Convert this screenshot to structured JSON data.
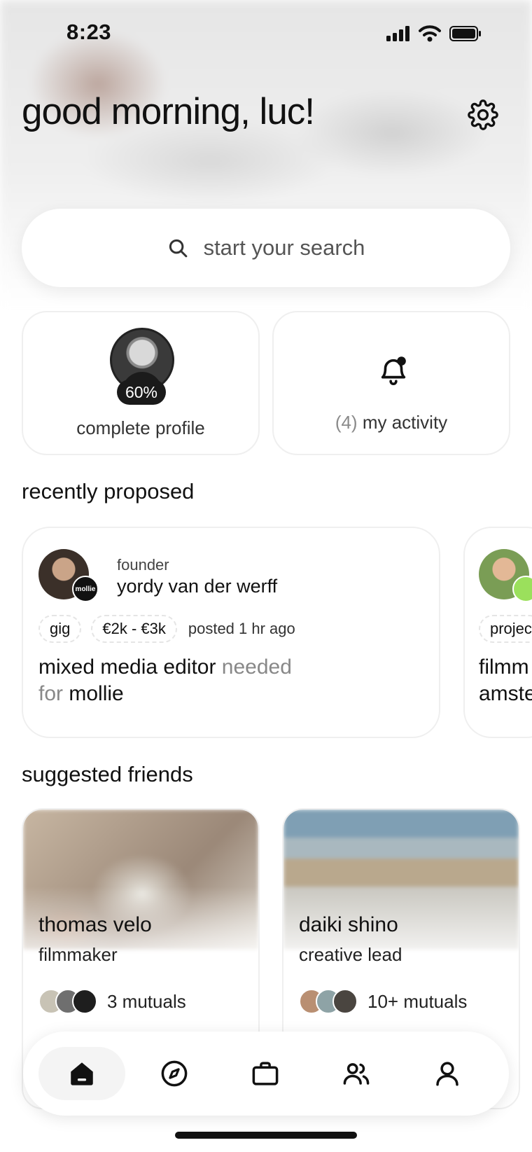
{
  "status_bar": {
    "time": "8:23"
  },
  "greeting": "good morning, luc!",
  "search": {
    "placeholder": "start your search"
  },
  "tiles": {
    "profile": {
      "percent": "60%",
      "label": "complete profile"
    },
    "activity": {
      "count": "(4)",
      "label": "my activity"
    }
  },
  "sections": {
    "recently_proposed": "recently proposed",
    "suggested_friends": "suggested friends"
  },
  "proposals": [
    {
      "role": "founder",
      "name": "yordy van der werff",
      "brand": "mollie",
      "chips": [
        "gig",
        "€2k - €3k"
      ],
      "posted": "posted 1 hr ago",
      "title_parts": [
        "mixed media editor",
        "needed",
        "for",
        "mollie"
      ]
    },
    {
      "chip": "projec",
      "title_lines": [
        "filmm",
        "amste"
      ]
    }
  ],
  "friends": [
    {
      "name": "thomas velo",
      "role": "filmmaker",
      "mutuals": "3 mutuals"
    },
    {
      "name": "daiki shino",
      "role": "creative lead",
      "mutuals": "10+ mutuals"
    }
  ],
  "tabbar": [
    "home-icon",
    "compass-icon",
    "briefcase-icon",
    "people-icon",
    "person-icon"
  ]
}
